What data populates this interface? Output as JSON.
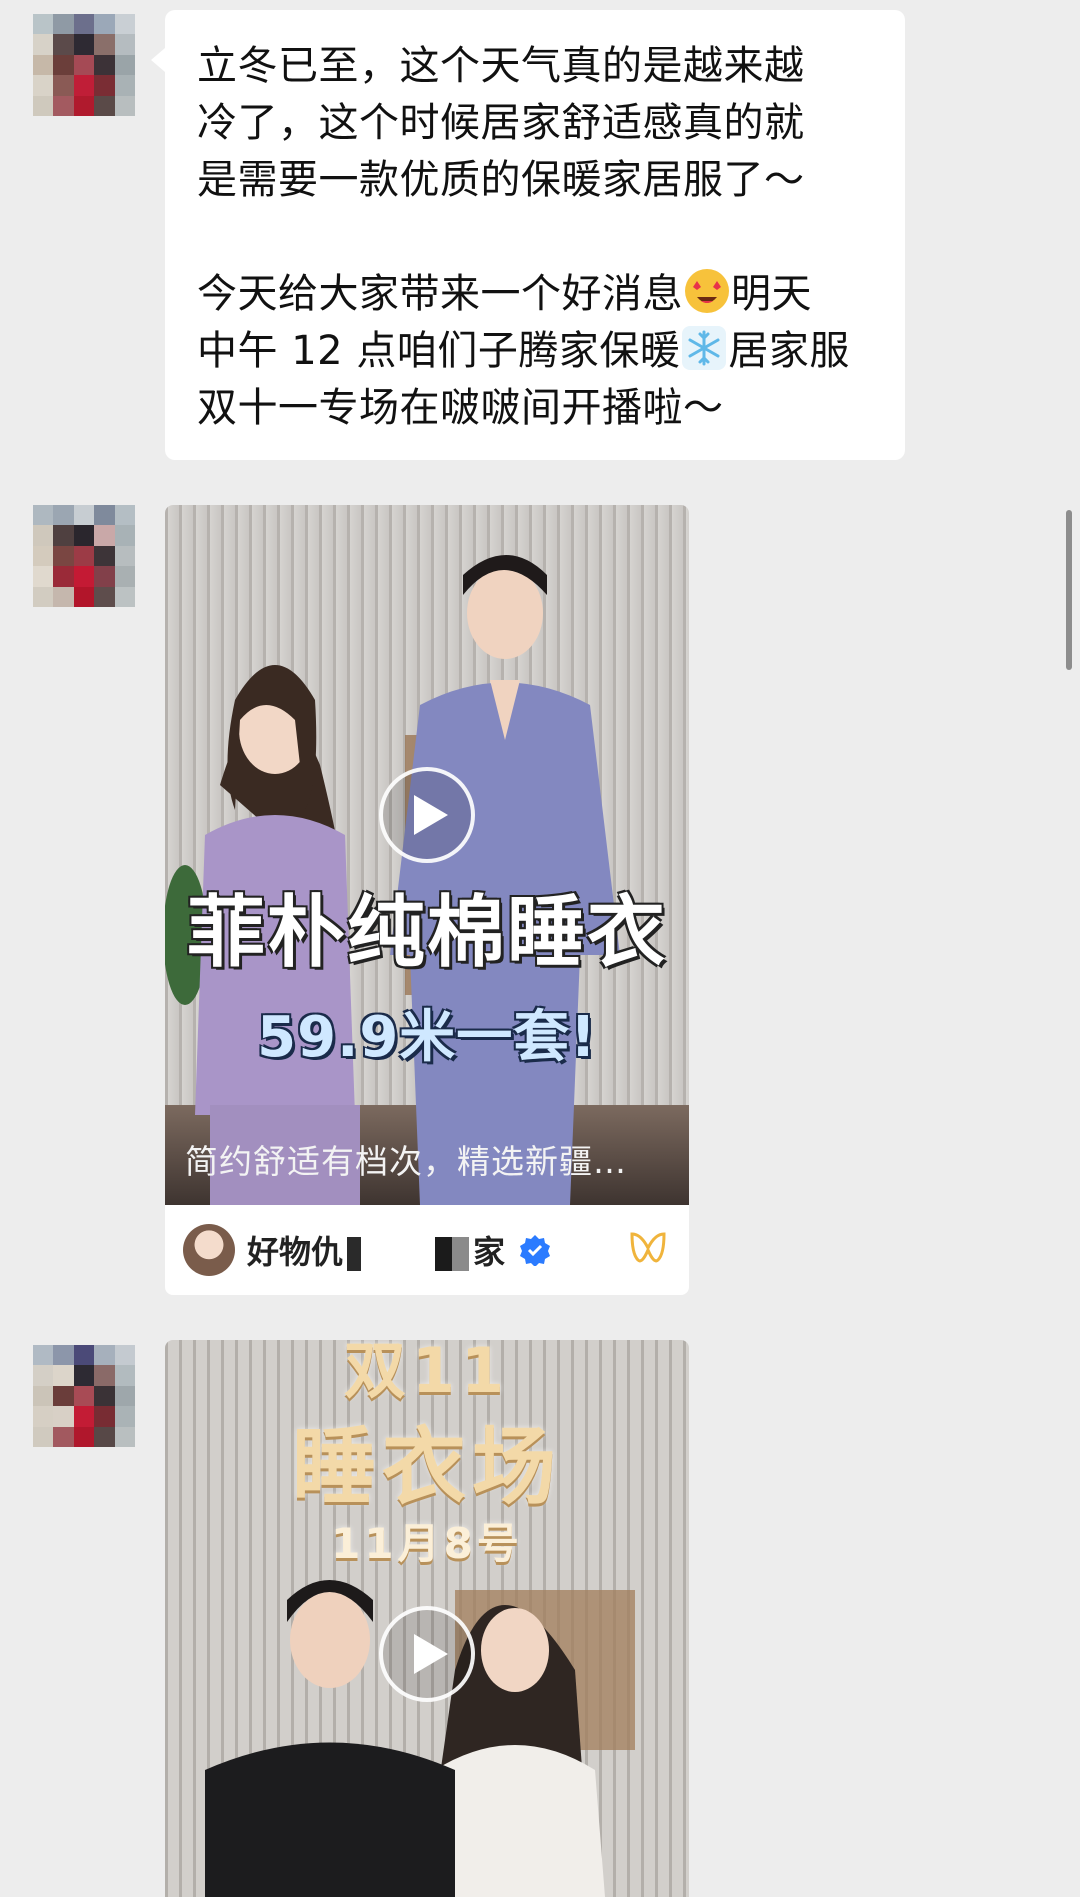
{
  "message1": {
    "lines": [
      "立冬已至，这个天气真的是越来越",
      "冷了，这个时候居家舒适感真的就",
      "是需要一款优质的保暖家居服了～",
      "今天给大家带来一个好消息",
      "明天",
      "中午 12 点咱们子腾家保暖",
      "居家服",
      "双十一专场在啵啵间开播啦～"
    ],
    "emoji_heart_eyes": "star-struck-emoji",
    "emoji_snowflake": "snowflake-emoji"
  },
  "video1": {
    "title_overlay": "菲朴纯棉睡衣",
    "price_overlay": "59.9米一套!",
    "caption": "简约舒适有档次，精选新疆…",
    "channel_name_part1": "好物仇",
    "channel_name_part2": "家",
    "verified_icon": "verified-badge-icon",
    "channels_icon": "wechat-channels-icon"
  },
  "video2": {
    "overlay_line1": "双11",
    "overlay_line2": "睡衣场",
    "overlay_line3": "11月8号"
  },
  "colors": {
    "background": "#ededed",
    "bubble": "#ffffff",
    "verified_blue": "#2b7bff",
    "channels_gold": "#f0b43c"
  }
}
